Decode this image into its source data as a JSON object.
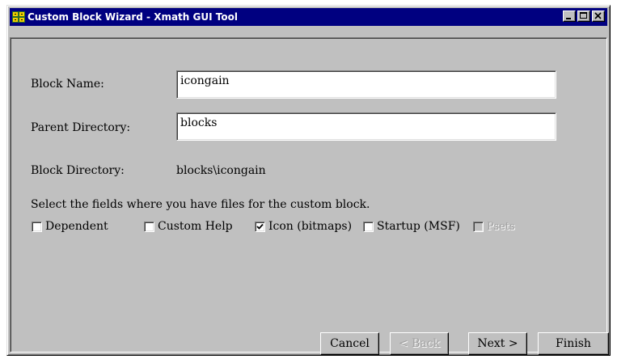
{
  "window": {
    "title": "Custom Block Wizard - Xmath GUI Tool",
    "icon": "xmath-app-icon",
    "controls": {
      "minimize": "minimize-icon",
      "maximize": "maximize-icon",
      "close": "close-icon"
    },
    "colors": {
      "titlebar": "#000080",
      "face": "#c0c0c0"
    }
  },
  "form": {
    "block_name_label": "Block Name:",
    "block_name_value": "icongain",
    "parent_dir_label": "Parent Directory:",
    "parent_dir_value": "blocks",
    "block_dir_label": "Block Directory:",
    "block_dir_value": "blocks\\icongain",
    "instructions": "Select the fields where you have files for the custom block."
  },
  "checkboxes": [
    {
      "label": "Dependent",
      "checked": false,
      "enabled": true
    },
    {
      "label": "Custom Help",
      "checked": false,
      "enabled": true
    },
    {
      "label": "Icon (bitmaps)",
      "checked": true,
      "enabled": true
    },
    {
      "label": "Startup (MSF)",
      "checked": false,
      "enabled": true
    },
    {
      "label": "Psets",
      "checked": false,
      "enabled": false
    }
  ],
  "buttons": {
    "cancel": {
      "label": "Cancel",
      "enabled": true
    },
    "back": {
      "label": "< Back",
      "enabled": false
    },
    "next": {
      "label": "Next >",
      "enabled": true
    },
    "finish": {
      "label": "Finish",
      "enabled": true
    }
  }
}
